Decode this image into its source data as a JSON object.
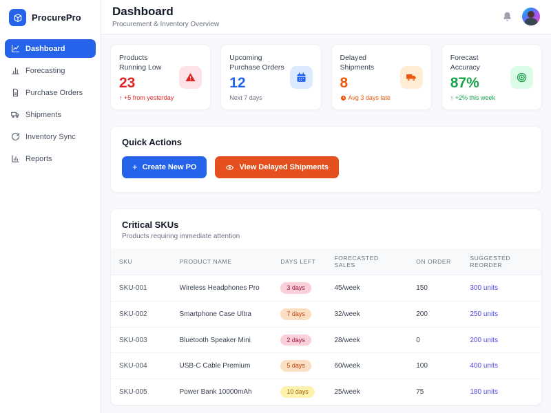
{
  "app": {
    "name": "ProcurePro",
    "brand_color": "#2563eb"
  },
  "sidebar": {
    "items": [
      {
        "label": "Dashboard",
        "icon": "line-chart-icon",
        "active": true
      },
      {
        "label": "Forecasting",
        "icon": "bar-chart-icon",
        "active": false
      },
      {
        "label": "Purchase Orders",
        "icon": "document-icon",
        "active": false
      },
      {
        "label": "Shipments",
        "icon": "truck-icon",
        "active": false
      },
      {
        "label": "Inventory Sync",
        "icon": "sync-icon",
        "active": false
      },
      {
        "label": "Reports",
        "icon": "report-icon",
        "active": false
      }
    ]
  },
  "header": {
    "title": "Dashboard",
    "subtitle": "Procurement & Inventory Overview"
  },
  "stat_cards": [
    {
      "label": "Products Running Low",
      "value": "23",
      "sub": "↑ +5 from yesterday",
      "sub_icon": "arrow-up",
      "icon": "warning-icon",
      "value_color": "#dc2626",
      "sub_color": "#dc2626",
      "icon_color": "#dc2626",
      "icon_bg": "#fdomitted",
      "icon_bg_fix": ""
    },
    {
      "label": "Upcoming Purchase Orders",
      "value": "12",
      "sub": "Next 7 days",
      "sub_icon": "none",
      "icon": "calendar-icon",
      "value_color": "#2563eb",
      "sub_color": "#6b7280",
      "icon_color": "#2563eb",
      "icon_bg": "#dbeafe"
    },
    {
      "label": "Delayed Shipments",
      "value": "8",
      "sub": "Avg 3 days late",
      "sub_icon": "clock",
      "icon": "truck-icon",
      "value_color": "#ea580c",
      "sub_color": "#ea580c",
      "icon_color": "#ea580c",
      "icon_bg": "#ffedd5"
    },
    {
      "label": "Forecast Accuracy",
      "value": "87%",
      "sub": "↑ +2% this week",
      "sub_icon": "arrow-up",
      "icon": "target-icon",
      "value_color": "#16a34a",
      "sub_color": "#16a34a",
      "icon_color": "#16a34a",
      "icon_bg": "#dcfce7"
    }
  ],
  "quick_actions": {
    "title": "Quick Actions",
    "buttons": [
      {
        "label": "Create New PO",
        "icon": "plus-icon",
        "icon_glyph": "+",
        "bg": "#2563eb"
      },
      {
        "label": "View Delayed Shipments",
        "icon": "eye-icon",
        "icon_glyph": "",
        "bg": "#e4511e"
      }
    ]
  },
  "critical_skus": {
    "title": "Critical SKUs",
    "subtitle": "Products requiring immediate attention",
    "columns": [
      "SKU",
      "PRODUCT NAME",
      "DAYS LEFT",
      "FORECASTED SALES",
      "ON ORDER",
      "SUGGESTED REORDER"
    ],
    "reorder_color": "#4f46e5",
    "severity_colors": {
      "red": {
        "bg": "#f9cfd9",
        "text": "#9f1239"
      },
      "orange": {
        "bg": "#fcdfc3",
        "text": "#c2410c"
      },
      "yellow": {
        "bg": "#fdf3ae",
        "text": "#a16207"
      }
    },
    "rows": [
      {
        "sku": "SKU-001",
        "product": "Wireless Headphones Pro",
        "days_left": "3 days",
        "severity": "red",
        "forecast": "45/week",
        "on_order": "150",
        "reorder": "300 units"
      },
      {
        "sku": "SKU-002",
        "product": "Smartphone Case Ultra",
        "days_left": "7 days",
        "severity": "orange",
        "forecast": "32/week",
        "on_order": "200",
        "reorder": "250 units"
      },
      {
        "sku": "SKU-003",
        "product": "Bluetooth Speaker Mini",
        "days_left": "2 days",
        "severity": "red",
        "forecast": "28/week",
        "on_order": "0",
        "reorder": "200 units"
      },
      {
        "sku": "SKU-004",
        "product": "USB-C Cable Premium",
        "days_left": "5 days",
        "severity": "orange",
        "forecast": "60/week",
        "on_order": "100",
        "reorder": "400 units"
      },
      {
        "sku": "SKU-005",
        "product": "Power Bank 10000mAh",
        "days_left": "10 days",
        "severity": "yellow",
        "forecast": "25/week",
        "on_order": "75",
        "reorder": "180 units"
      }
    ]
  },
  "stat_card_icon_bgs": [
    "#fde2e7",
    "#dbeafe",
    "#ffedd5",
    "#dcfce7"
  ]
}
